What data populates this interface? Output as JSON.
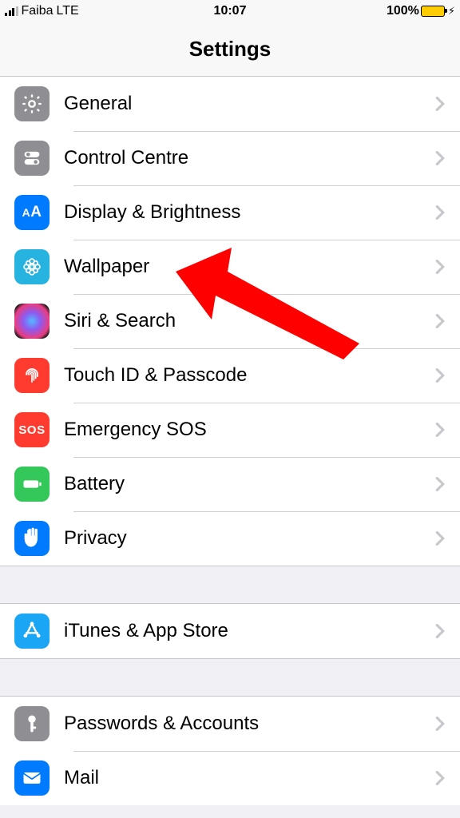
{
  "statusbar": {
    "carrier": "Faiba",
    "network": "LTE",
    "time": "10:07",
    "battery_pct": "100%"
  },
  "navbar": {
    "title": "Settings"
  },
  "sections": [
    {
      "rows": [
        {
          "id": "general",
          "label": "General"
        },
        {
          "id": "control-centre",
          "label": "Control Centre"
        },
        {
          "id": "display-brightness",
          "label": "Display & Brightness"
        },
        {
          "id": "wallpaper",
          "label": "Wallpaper"
        },
        {
          "id": "siri-search",
          "label": "Siri & Search"
        },
        {
          "id": "touch-id-passcode",
          "label": "Touch ID & Passcode"
        },
        {
          "id": "emergency-sos",
          "label": "Emergency SOS"
        },
        {
          "id": "battery",
          "label": "Battery"
        },
        {
          "id": "privacy",
          "label": "Privacy"
        }
      ]
    },
    {
      "rows": [
        {
          "id": "itunes-app-store",
          "label": "iTunes & App Store"
        }
      ]
    },
    {
      "rows": [
        {
          "id": "passwords-accounts",
          "label": "Passwords & Accounts"
        },
        {
          "id": "mail",
          "label": "Mail"
        }
      ]
    }
  ],
  "annotation": {
    "points_to": "wallpaper",
    "color": "#ff0000"
  }
}
